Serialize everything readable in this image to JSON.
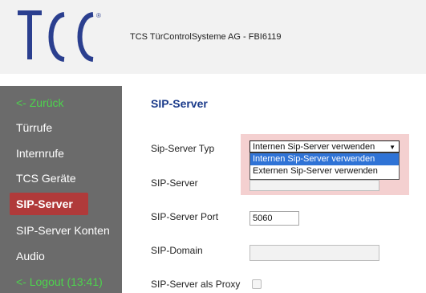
{
  "header": {
    "company": "TCS TürControlSysteme AG - FBI6119"
  },
  "sidebar": {
    "items": [
      {
        "label": "<- Zurück"
      },
      {
        "label": "Türrufe"
      },
      {
        "label": "Internrufe"
      },
      {
        "label": "TCS Geräte"
      },
      {
        "label": "SIP-Server"
      },
      {
        "label": "SIP-Server Konten"
      },
      {
        "label": "Audio"
      },
      {
        "label": "<- Logout (13:41)"
      }
    ],
    "active_index": 4
  },
  "main": {
    "title": "SIP-Server",
    "fields": {
      "sip_server_typ": {
        "label": "Sip-Server Typ",
        "selected": "Internen Sip-Server verwenden",
        "options": [
          "Internen Sip-Server verwenden",
          "Externen Sip-Server verwenden"
        ]
      },
      "sip_server": {
        "label": "SIP-Server",
        "value": ""
      },
      "sip_server_port": {
        "label": "SIP-Server Port",
        "value": "5060"
      },
      "sip_domain": {
        "label": "SIP-Domain",
        "value": ""
      },
      "sip_server_proxy": {
        "label": "SIP-Server als Proxy",
        "checked": false
      }
    }
  },
  "colors": {
    "sidebar_bg": "#6b6b6b",
    "sidebar_active": "#b03a3a",
    "green_link": "#4dd34d",
    "title_blue": "#1a3a8a",
    "highlight": "#f4d0d0",
    "selected_option": "#2f73d6"
  }
}
